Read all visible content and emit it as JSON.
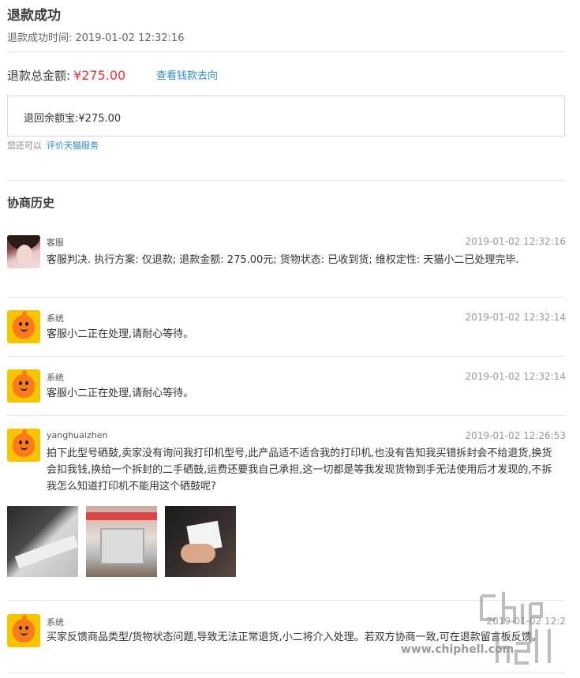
{
  "header": {
    "title": "退款成功",
    "time_label": "退款成功时间:",
    "time_value": "2019-01-02 12:32:16"
  },
  "refund": {
    "total_label": "退款总金额:",
    "total_amount": "¥275.00",
    "view_money_link": "查看钱款去向",
    "balance_text": "退回余额宝:¥275.00",
    "also_label": "您还可以",
    "review_link": "评价天猫服务"
  },
  "history": {
    "title": "协商历史",
    "entries": [
      {
        "author": "客服",
        "time": "2019-01-02 12:32:16",
        "avatar": "photo",
        "message": "客服判决. 执行方案: 仅退款; 退款金额: 275.00元; 货物状态: 已收到货; 维权定性: 天猫小二已处理完毕."
      },
      {
        "author": "系统",
        "time": "2019-01-02 12:32:14",
        "avatar": "robot",
        "message": "客服小二正在处理,请耐心等待。"
      },
      {
        "author": "系统",
        "time": "2019-01-02 12:32:14",
        "avatar": "robot",
        "message": "客服小二正在处理,请耐心等待。"
      },
      {
        "author": "yanghuaizhen",
        "time": "2019-01-02 12:26:53",
        "avatar": "robot",
        "message": "拍下此型号硒鼓,卖家没有询问我打印机型号,此产品适不适合我的打印机,也没有告知我买错拆封会不给退货,换货会扣我钱,换给一个拆封的二手硒鼓,运费还要我自己承担,这一切都是等我发现货物到手无法使用后才发现的,不拆我怎么知道打印机不能用这个硒鼓呢?"
      },
      {
        "author": "系统",
        "time": "2019-01-02 12:2",
        "avatar": "robot",
        "message": "买家反馈商品类型/货物状态问题,导致无法正常退货,小二将介入处理。若双方协商一致,可在退款留言板反馈。"
      }
    ]
  },
  "watermark": {
    "text": "www.chiphell.com",
    "logo_text": "chip hell"
  },
  "colors": {
    "accent_red": "#e4393c",
    "link_blue": "#2d8ec7"
  }
}
